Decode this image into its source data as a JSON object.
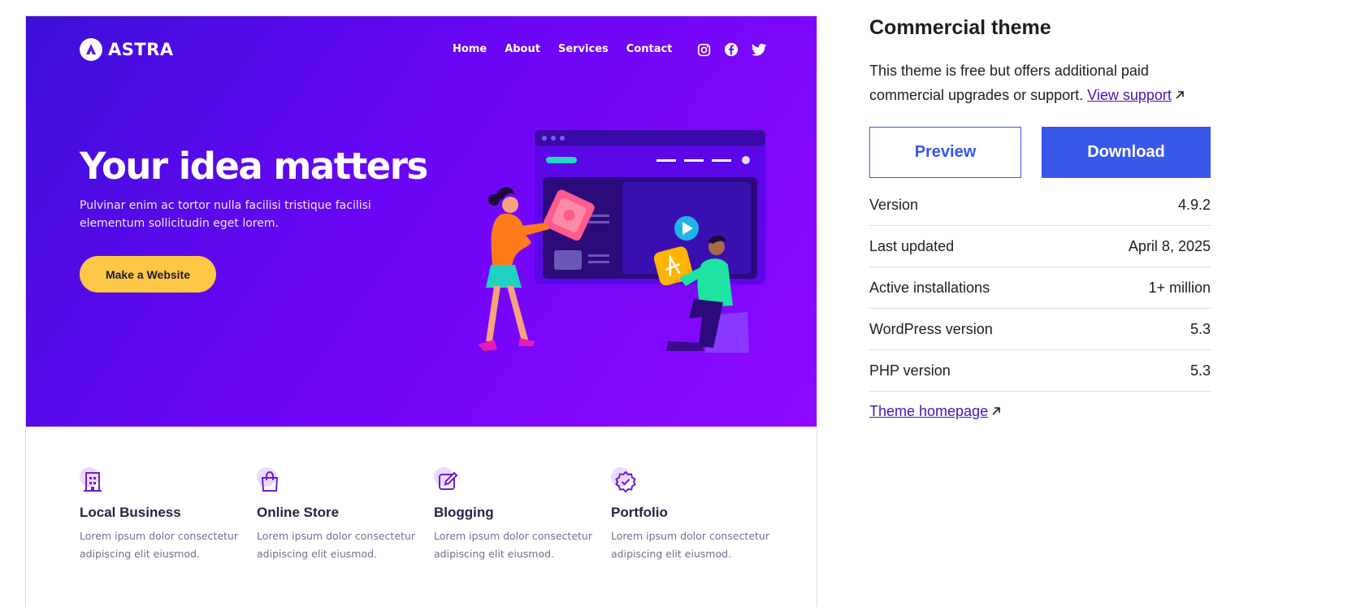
{
  "preview": {
    "logo_text": "ASTRA",
    "nav": [
      "Home",
      "About",
      "Services",
      "Contact"
    ],
    "social_icons": [
      "instagram-icon",
      "facebook-icon",
      "twitter-icon"
    ],
    "hero_title": "Your idea matters",
    "hero_subtitle": "Pulvinar enim ac tortor nulla facilisi tristique facilisi elementum sollicitudin eget lorem.",
    "hero_cta": "Make a Website",
    "features": [
      {
        "icon": "building-icon",
        "title": "Local Business",
        "text": "Lorem ipsum dolor consectetur adipiscing elit eiusmod."
      },
      {
        "icon": "shopping-bag-icon",
        "title": "Online Store",
        "text": "Lorem ipsum dolor consectetur adipiscing elit eiusmod."
      },
      {
        "icon": "edit-icon",
        "title": "Blogging",
        "text": "Lorem ipsum dolor consectetur adipiscing elit eiusmod."
      },
      {
        "icon": "badge-check-icon",
        "title": "Portfolio",
        "text": "Lorem ipsum dolor consectetur adipiscing elit eiusmod."
      }
    ]
  },
  "panel": {
    "title": "Commercial theme",
    "note": "This theme is free but offers additional paid commercial upgrades or support.",
    "view_support": "View support",
    "preview_button": "Preview",
    "download_button": "Download",
    "meta": [
      {
        "label": "Version",
        "value": "4.9.2"
      },
      {
        "label": "Last updated",
        "value": "April 8, 2025"
      },
      {
        "label": "Active installations",
        "value": "1+ million"
      },
      {
        "label": "WordPress version",
        "value": "5.3"
      },
      {
        "label": "PHP version",
        "value": "5.3"
      }
    ],
    "homepage_link": "Theme homepage"
  },
  "colors": {
    "accent": "#3858e9",
    "hero_gradient_start": "#3d0fd8",
    "hero_gradient_end": "#8e08ff",
    "cta": "#ffc746"
  }
}
